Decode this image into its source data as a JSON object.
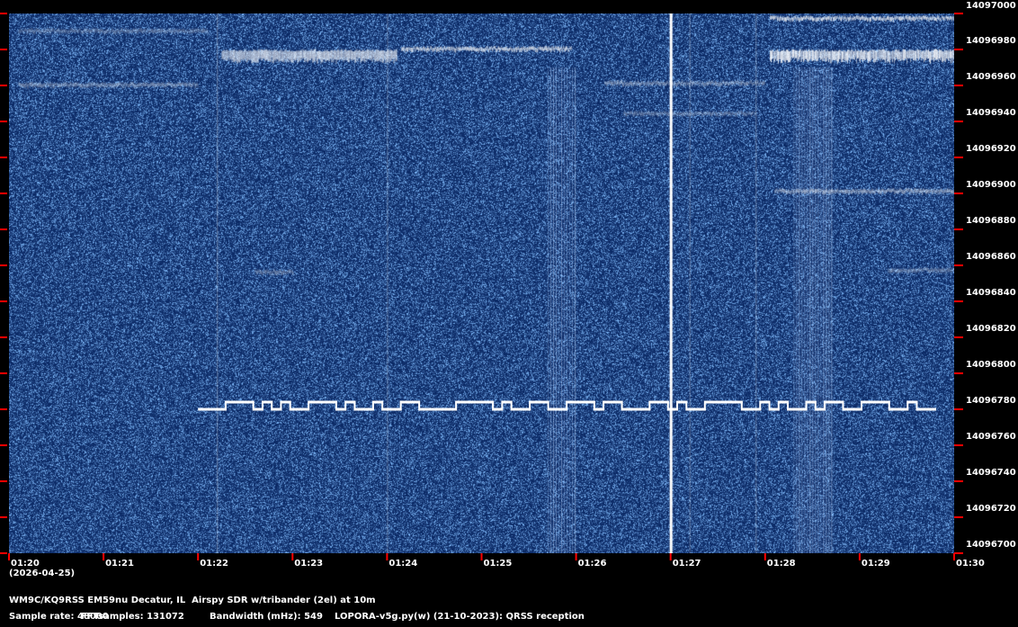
{
  "chart_data": {
    "type": "heatmap",
    "title": "QRSS waterfall spectrogram",
    "date": "(2026-04-25)",
    "x_ticks": [
      "01:20",
      "01:21",
      "01:22",
      "01:23",
      "01:24",
      "01:25",
      "01:26",
      "01:27",
      "01:28",
      "01:29",
      "01:30"
    ],
    "x_range_minutes": [
      0,
      10
    ],
    "y_ticks": [
      "14097000",
      "14096980",
      "14096960",
      "14096940",
      "14096920",
      "14096900",
      "14096880",
      "14096860",
      "14096840",
      "14096820",
      "14096800",
      "14096780",
      "14096760",
      "14096740",
      "14096720",
      "14096700"
    ],
    "y_range_hz": [
      14096700,
      14097000
    ],
    "colors": {
      "background": "#0b2a66",
      "noise": "#2a5aa8",
      "signal": "#ffffff",
      "tick": "#ff0000"
    },
    "traces": [
      {
        "name": "fsk-cw-signal",
        "t": [
          2.0,
          9.8
        ],
        "freq": 14096780,
        "shift_hz": 4,
        "intensity": 1.0
      },
      {
        "name": "strong-band-a",
        "t": [
          2.25,
          4.1
        ],
        "freq": 14096976,
        "intensity": 0.95
      },
      {
        "name": "band-b",
        "t": [
          4.15,
          5.95
        ],
        "freq": 14096980,
        "intensity": 0.85
      },
      {
        "name": "strong-band-c",
        "t": [
          8.05,
          10.0
        ],
        "freq": 14096976,
        "intensity": 0.95
      },
      {
        "name": "top-band",
        "t": [
          8.05,
          10.0
        ],
        "freq": 14096997,
        "intensity": 0.8
      },
      {
        "name": "faint-990",
        "t": [
          0.1,
          2.1
        ],
        "freq": 14096990,
        "intensity": 0.35
      },
      {
        "name": "faint-960a",
        "t": [
          0.1,
          2.0
        ],
        "freq": 14096960,
        "intensity": 0.45
      },
      {
        "name": "faint-960b",
        "t": [
          6.3,
          8.0
        ],
        "freq": 14096961,
        "intensity": 0.45
      },
      {
        "name": "faint-940",
        "t": [
          6.5,
          7.9
        ],
        "freq": 14096944,
        "intensity": 0.35
      },
      {
        "name": "band-900",
        "t": [
          8.1,
          10.0
        ],
        "freq": 14096901,
        "intensity": 0.6
      },
      {
        "name": "band-855a",
        "t": [
          2.6,
          3.0
        ],
        "freq": 14096856,
        "intensity": 0.4
      },
      {
        "name": "band-855b",
        "t": [
          9.3,
          10.0
        ],
        "freq": 14096857,
        "intensity": 0.4
      }
    ],
    "verticals": [
      {
        "t": 7.0,
        "intensity": 1.0
      },
      {
        "t": 2.2,
        "intensity": 0.35
      },
      {
        "t": 4.0,
        "intensity": 0.3
      },
      {
        "t": 7.2,
        "intensity": 0.3
      },
      {
        "t": 7.9,
        "intensity": 0.3
      }
    ],
    "bursts": [
      {
        "t": [
          5.7,
          6.0
        ],
        "freq": [
          14096700,
          14096970
        ],
        "intensity": 0.55
      },
      {
        "t": [
          8.3,
          8.7
        ],
        "freq": [
          14096700,
          14096970
        ],
        "intensity": 0.55
      }
    ]
  },
  "footer": {
    "station": "WM9C/KQ9RSS EM59nu Decatur, IL  Airspy SDR w/tribander (2el) at 10m",
    "sample_rate": "Sample rate: 48000",
    "fft": "FFTsamples: 131072",
    "bandwidth": "Bandwidth (mHz): 549",
    "software": "LOPORA-v5g.py(w) (21-10-2023): QRSS reception"
  }
}
